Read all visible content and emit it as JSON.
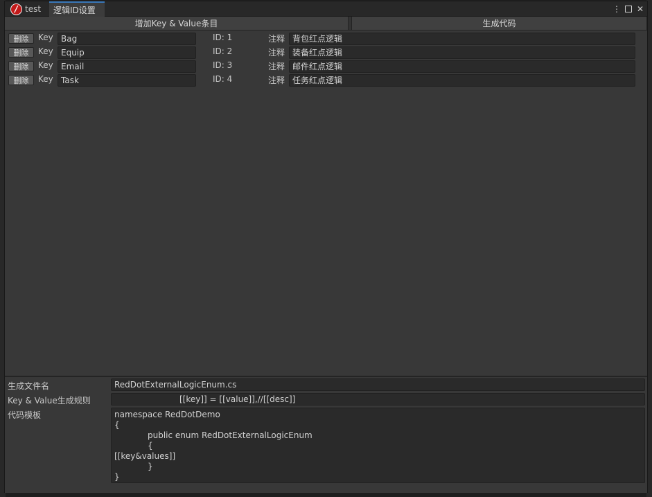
{
  "window": {
    "tabs": [
      {
        "label": "test",
        "active": false
      },
      {
        "label": "逻辑ID设置",
        "active": true
      }
    ],
    "menu_glyph": "⋮",
    "close_glyph": "✕"
  },
  "toolbar": {
    "add_label": "增加Key & Value条目",
    "generate_label": "生成代码"
  },
  "rows": [
    {
      "delete": "删除",
      "key_label": "Key",
      "key": "Bag",
      "id": "ID: 1",
      "note_label": "注释",
      "note": "背包红点逻辑"
    },
    {
      "delete": "删除",
      "key_label": "Key",
      "key": "Equip",
      "id": "ID: 2",
      "note_label": "注释",
      "note": "装备红点逻辑"
    },
    {
      "delete": "删除",
      "key_label": "Key",
      "key": "Email",
      "id": "ID: 3",
      "note_label": "注释",
      "note": "邮件红点逻辑"
    },
    {
      "delete": "删除",
      "key_label": "Key",
      "key": "Task",
      "id": "ID: 4",
      "note_label": "注释",
      "note": "任务红点逻辑"
    }
  ],
  "settings": {
    "filename_label": "生成文件名",
    "filename": "RedDotExternalLogicEnum.cs",
    "rule_label": "Key & Value生成规则",
    "rule": "[[key]] = [[value]],//[[desc]]",
    "template_label": "代码模板",
    "template_lines": [
      "namespace RedDotDemo",
      "{",
      "public enum RedDotExternalLogicEnum",
      "{",
      "[[key&values]]",
      "}",
      "}"
    ]
  },
  "colors": {
    "window_bg": "#383838",
    "field_bg": "#2a2a2a",
    "tab_accent": "#3a79bb",
    "logo_red": "#c21a1a"
  }
}
